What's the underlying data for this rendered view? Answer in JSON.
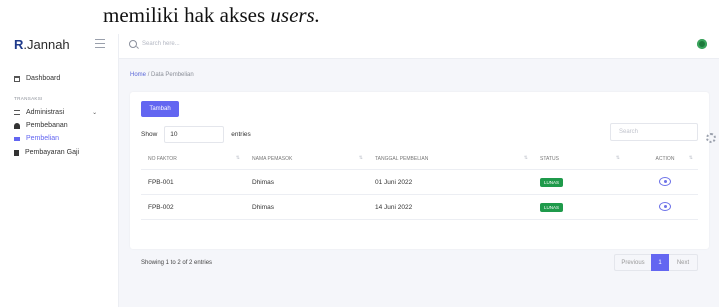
{
  "caption": {
    "text": "memiliki hak akses ",
    "italic": "users."
  },
  "brand": {
    "initial": "R",
    "rest": ".Jannah"
  },
  "search": {
    "placeholder": "Search here..."
  },
  "sidebar": {
    "dashboard": "Dashboard",
    "section": "TRANSAKSI",
    "items": [
      {
        "label": "Administrasi",
        "icon": "list-icon"
      },
      {
        "label": "Pembebanan",
        "icon": "user-icon"
      },
      {
        "label": "Pembelian",
        "icon": "truck-icon",
        "active": true
      },
      {
        "label": "Pembayaran Gaji",
        "icon": "file-icon"
      }
    ]
  },
  "breadcrumb": {
    "home": "Home",
    "sep": "/",
    "current": "Data Pembelian"
  },
  "toolbar": {
    "add_label": "Tambah",
    "show_label": "Show",
    "show_value": "10",
    "entries_label": "entries",
    "search_placeholder": "Search"
  },
  "table": {
    "headers": [
      "NO FAKTOR",
      "NAMA PEMASOK",
      "TANGGAL PEMBELIAN",
      "STATUS",
      "ACTION"
    ],
    "rows": [
      {
        "no": "FPB-001",
        "pemasok": "Dhimas",
        "tanggal": "01 Juni 2022",
        "status": "LUNAS"
      },
      {
        "no": "FPB-002",
        "pemasok": "Dhimas",
        "tanggal": "14 Juni 2022",
        "status": "LUNAS"
      }
    ]
  },
  "footer": {
    "info": "Showing 1 to 2 of 2 entries",
    "prev": "Previous",
    "page": "1",
    "next": "Next"
  },
  "colors": {
    "accent": "#6366f1",
    "success": "#1f9a4b"
  }
}
